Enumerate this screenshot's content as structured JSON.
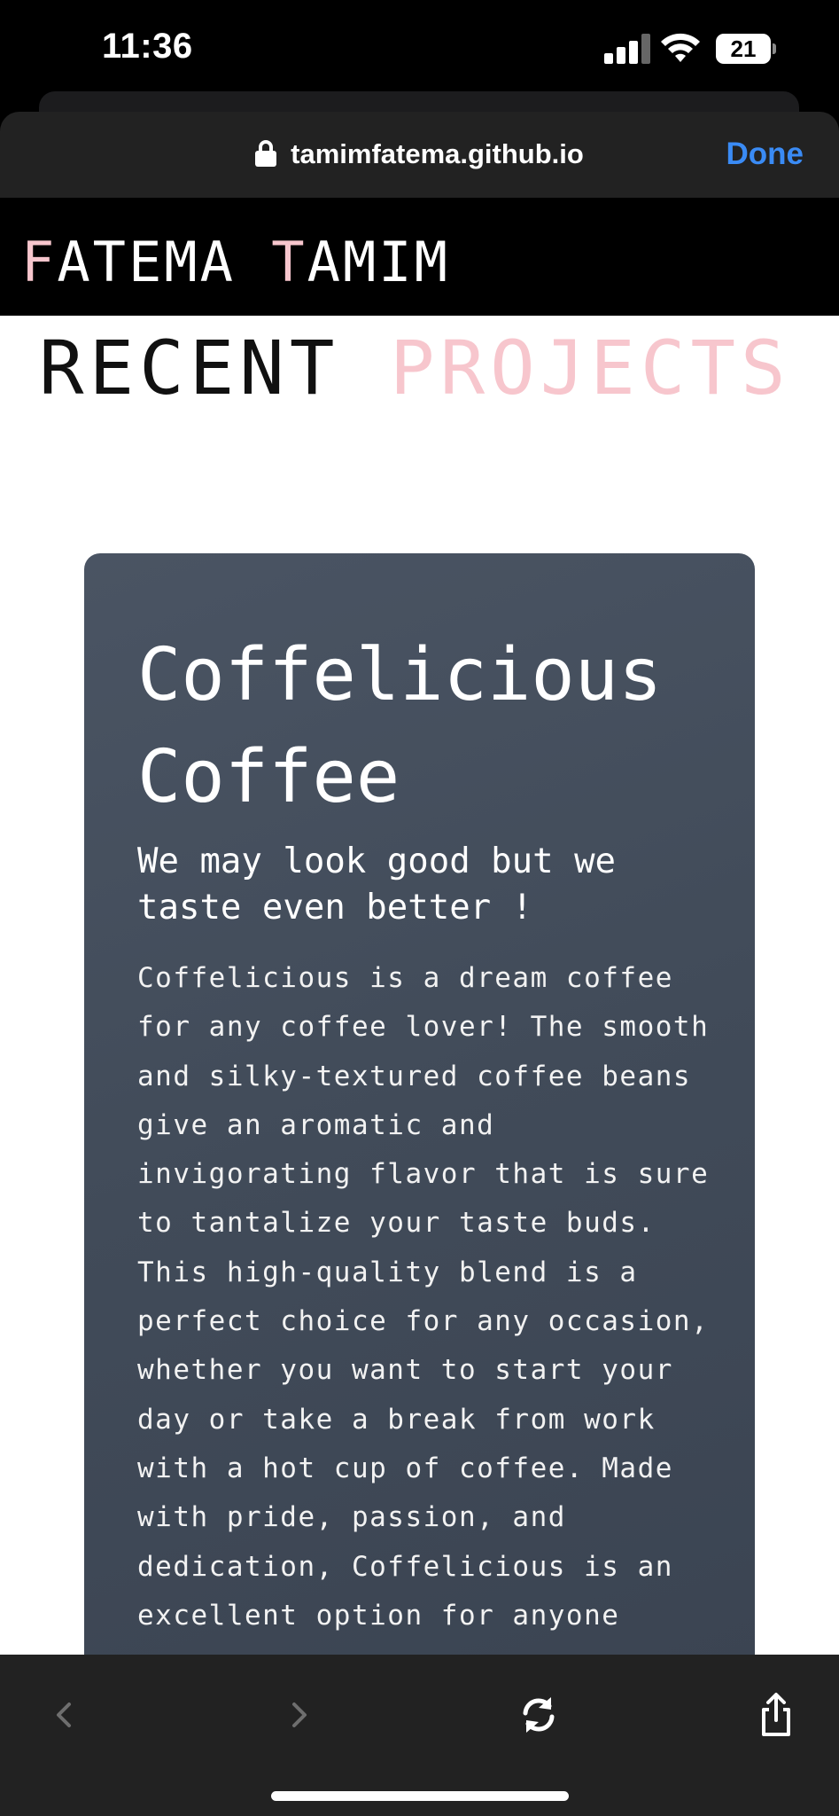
{
  "status_bar": {
    "time": "11:36",
    "battery": "21",
    "icons": [
      "cellular-signal-icon",
      "wifi-icon",
      "battery-icon"
    ]
  },
  "browser": {
    "url": "tamimfatema.github.io",
    "done_label": "Done",
    "toolbar_icons": [
      "back-icon",
      "forward-icon",
      "reload-icon",
      "share-icon"
    ]
  },
  "site": {
    "logo_first_initial": "F",
    "logo_first_rest": "ATEMA",
    "logo_last_initial": "T",
    "logo_last_rest": "AMIM",
    "accent_color": "#f7c6cd"
  },
  "section": {
    "title_word1": "RECENT",
    "title_word2": "PROJECTS"
  },
  "project": {
    "title": "Coffelicious Coffee",
    "tagline": "We may look good but we taste even better !",
    "description": "Coffelicious is a dream coffee for any coffee lover! The smooth and silky-textured coffee beans give an aromatic and invigorating flavor that is sure to tantalize your taste buds. This high-quality blend is a perfect choice for any occasion, whether you want to start your day or take a break from work with a hot cup of coffee. Made with pride, passion, and dedication, Coffelicious is an excellent option for anyone"
  }
}
